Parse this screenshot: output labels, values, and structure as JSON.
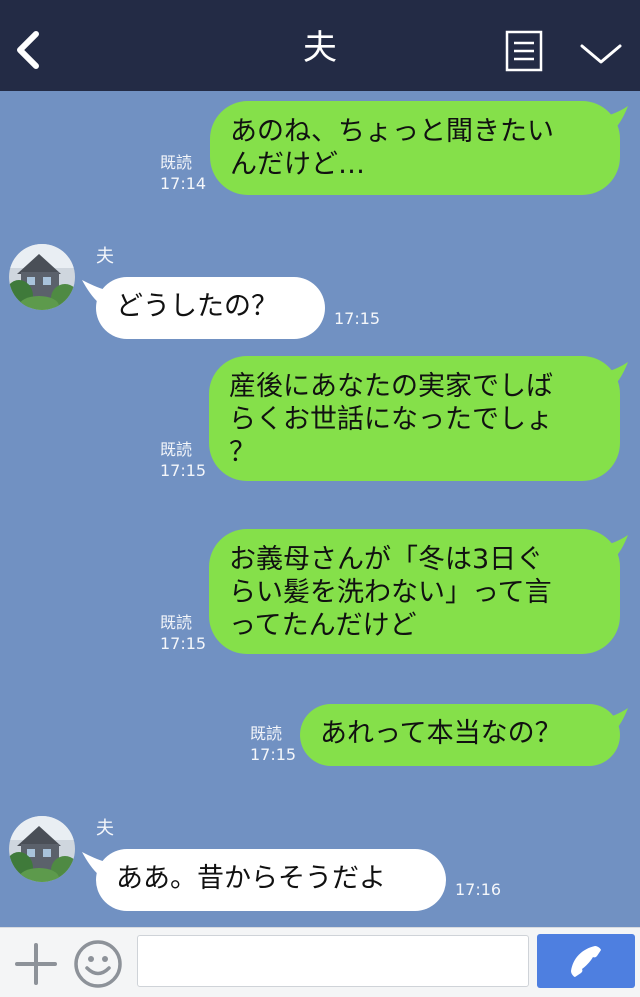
{
  "header": {
    "back_icon": "chevron-left-icon",
    "title": "夫",
    "menu_icon": "list-menu-icon",
    "collapse_icon": "chevron-down-icon",
    "background": "#232b45"
  },
  "chat": {
    "background": "#7191c2",
    "outgoing_bubble_color": "#85e04a",
    "incoming_bubble_color": "#ffffff",
    "messages": [
      {
        "sender": "me",
        "text": "あのね、ちょっと聞きたい\nんだけど…",
        "read": "既読",
        "time": "17:14"
      },
      {
        "sender": "other",
        "name": "夫",
        "text": "どうしたの？",
        "time": "17:15"
      },
      {
        "sender": "me",
        "text": "産後にあなたの実家でしば\nらくお世話になったでしょ\n？",
        "read": "既読",
        "time": "17:15"
      },
      {
        "sender": "me",
        "text": "お義母さんが「冬は3日ぐ\nらい髪を洗わない」って言\nってたんだけど",
        "read": "既読",
        "time": "17:15"
      },
      {
        "sender": "me",
        "text": "あれって本当なの？",
        "read": "既読",
        "time": "17:15"
      },
      {
        "sender": "other",
        "name": "夫",
        "text": "ああ。昔からそうだよ",
        "time": "17:16"
      }
    ]
  },
  "input_bar": {
    "plus_icon": "plus-icon",
    "emoji_icon": "smiley-icon",
    "input_value": "",
    "call_icon": "phone-icon",
    "call_button_color": "#4e7fe0"
  }
}
